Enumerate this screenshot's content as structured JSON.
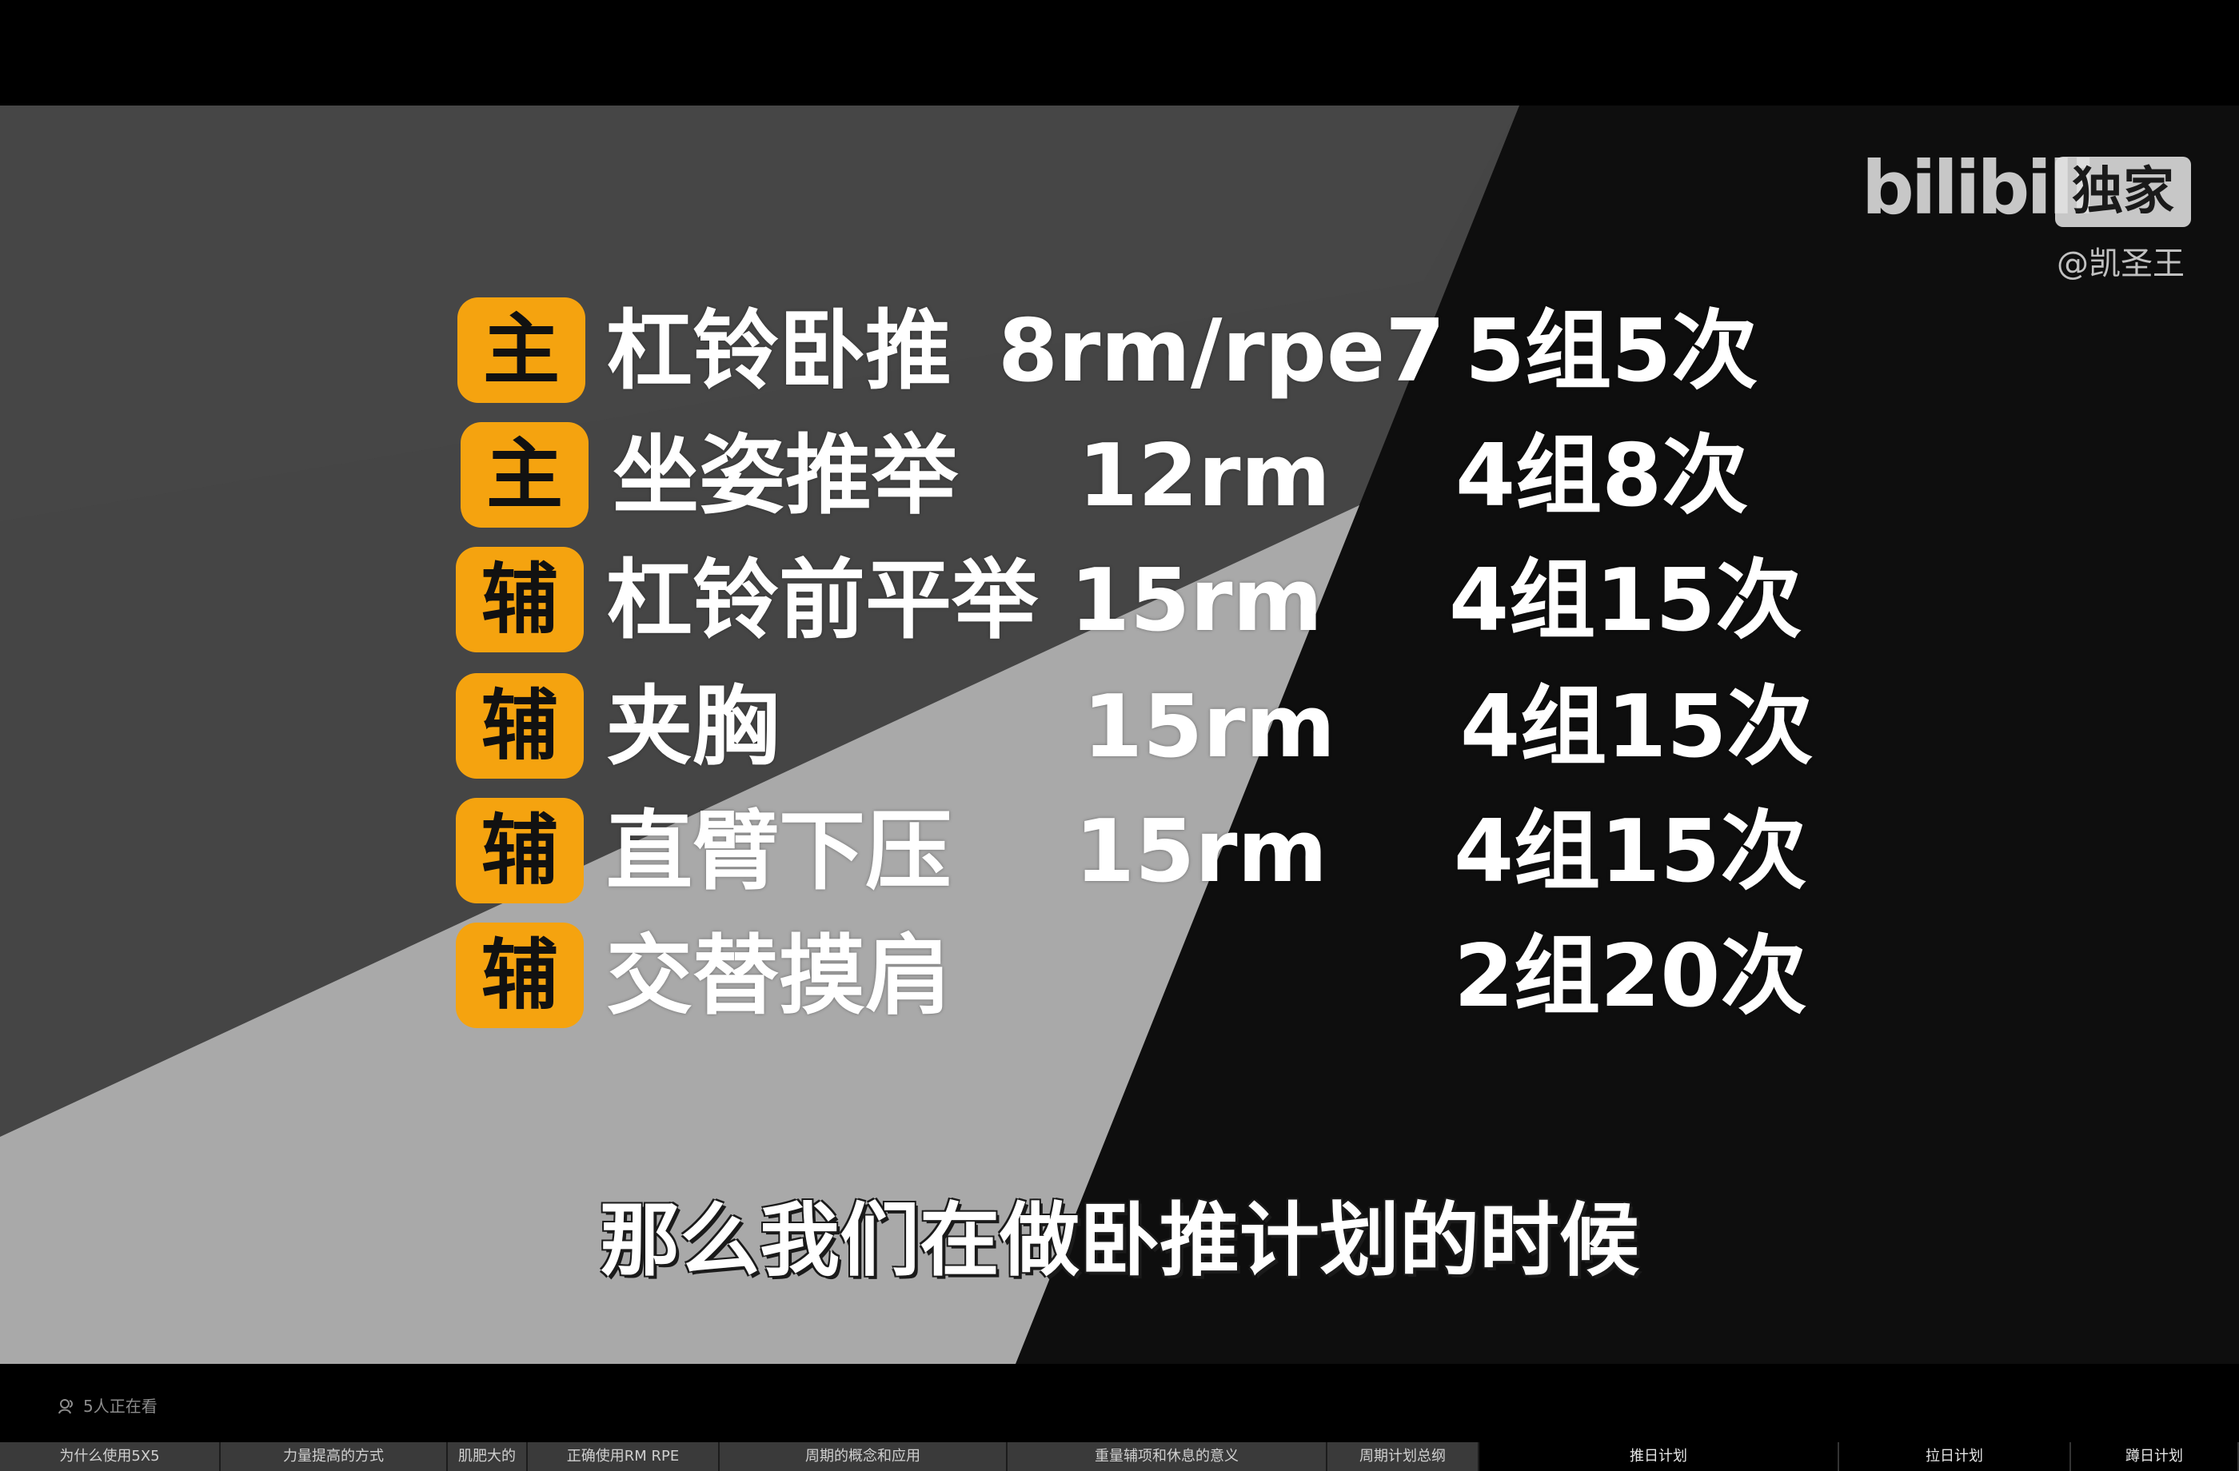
{
  "watermark": {
    "logo": "bilibili",
    "badge": "独家",
    "author": "@凯圣王"
  },
  "workout": [
    {
      "tag": "主",
      "exercise": "杠铃卧推",
      "intensity": "8rm/rpe7",
      "sets_reps": "5组5次"
    },
    {
      "tag": "主",
      "exercise": "坐姿推举",
      "intensity": "12rm",
      "sets_reps": "4组8次"
    },
    {
      "tag": "辅",
      "exercise": "杠铃前平举",
      "intensity": "15rm",
      "sets_reps": "4组15次"
    },
    {
      "tag": "辅",
      "exercise": "夹胸",
      "intensity": "15rm",
      "sets_reps": "4组15次"
    },
    {
      "tag": "辅",
      "exercise": "直臂下压",
      "intensity": "15rm",
      "sets_reps": "4组15次"
    },
    {
      "tag": "辅",
      "exercise": "交替摸肩",
      "intensity": "",
      "sets_reps": "2组20次"
    }
  ],
  "subtitle": "那么我们在做卧推计划的时候",
  "viewers": {
    "icon": "viewers-icon",
    "text": "5人正在看"
  },
  "chapters": [
    {
      "label": "为什么使用5X5",
      "state": "watched"
    },
    {
      "label": "力量提高的方式",
      "state": "watched"
    },
    {
      "label": "肌肥大的",
      "state": "watched"
    },
    {
      "label": "正确使用RM RPE",
      "state": "watched"
    },
    {
      "label": "周期的概念和应用",
      "state": "watched"
    },
    {
      "label": "重量辅项和休息的意义",
      "state": "watched"
    },
    {
      "label": "周期计划总纲",
      "state": "watched"
    },
    {
      "label": "推日计划",
      "state": "upcoming"
    },
    {
      "label": "拉日计划",
      "state": "upcoming"
    },
    {
      "label": "蹲日计划",
      "state": "upcoming"
    }
  ],
  "colors": {
    "tag_bg": "#f5a30f",
    "chapter_watched": "#3a3a3a",
    "chapter_upcoming": "#000000"
  }
}
